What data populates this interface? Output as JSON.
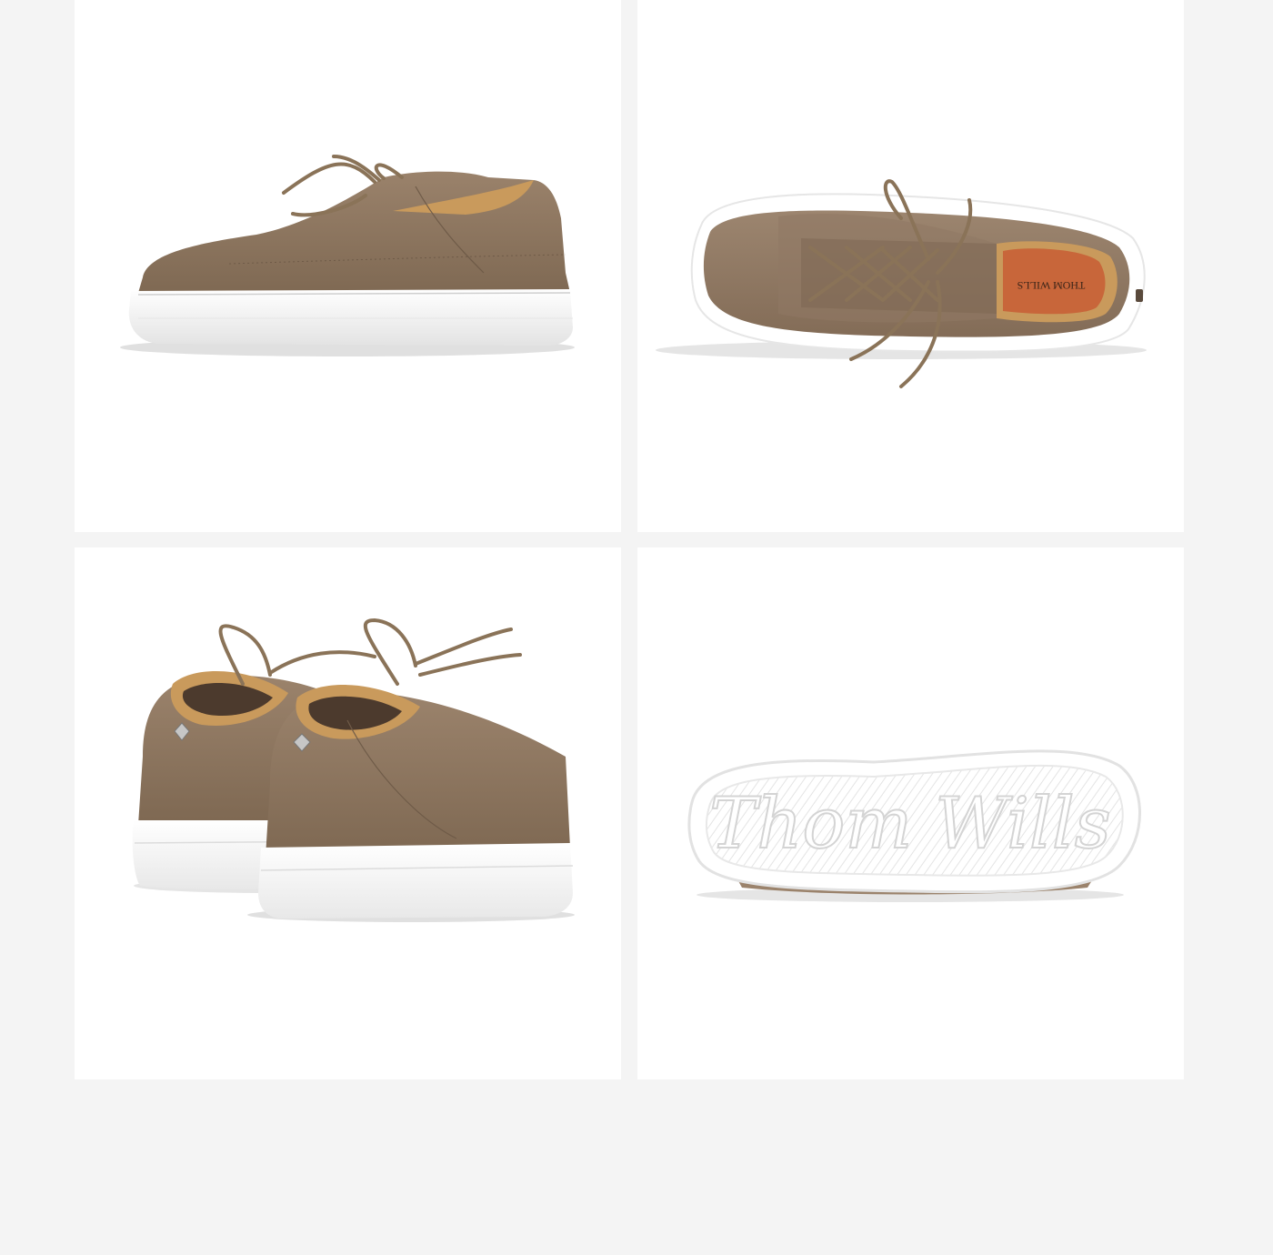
{
  "gallery": {
    "background": "#f4f4f4",
    "tile_background": "#ffffff",
    "items": [
      {
        "view": "side profile",
        "icon": "sneaker-side-view"
      },
      {
        "view": "top down",
        "icon": "sneaker-top-view"
      },
      {
        "view": "back pair",
        "icon": "sneaker-pair-back-view"
      },
      {
        "view": "outsole",
        "icon": "sneaker-outsole-view"
      }
    ]
  },
  "product": {
    "insole_brand": "THOM WILLS",
    "outsole_brand": "Thom Wills",
    "colors": {
      "suede": "#8c7560",
      "suede_dark": "#6f5b48",
      "sole": "#ffffff",
      "lining": "#c99a5c",
      "insole": "#c8663a",
      "lace": "#8a7358"
    }
  }
}
